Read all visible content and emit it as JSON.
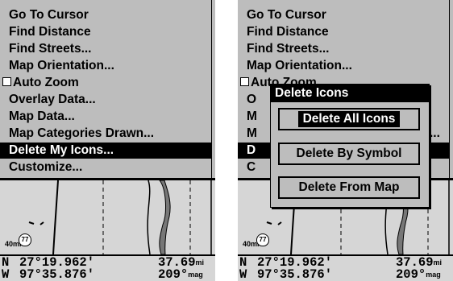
{
  "left_menu": {
    "items": [
      {
        "label": "Go To Cursor"
      },
      {
        "label": "Find Distance"
      },
      {
        "label": "Find Streets..."
      },
      {
        "label": "Map Orientation..."
      },
      {
        "label": "Auto Zoom",
        "checkbox": true,
        "checked": false
      },
      {
        "label": "Overlay Data..."
      },
      {
        "label": "Map Data..."
      },
      {
        "label": "Map Categories Drawn..."
      },
      {
        "label": "Delete My Icons...",
        "selected": true
      },
      {
        "label": "Customize..."
      }
    ]
  },
  "right_menu": {
    "items": [
      {
        "label": "Go To Cursor"
      },
      {
        "label": "Find Distance"
      },
      {
        "label": "Find Streets..."
      },
      {
        "label": "Map Orientation..."
      },
      {
        "label": "Auto Zoom"
      },
      {
        "label": "O"
      },
      {
        "label": "M"
      },
      {
        "label": "M"
      },
      {
        "label": "D"
      },
      {
        "label": "C"
      }
    ],
    "peek_text": "..."
  },
  "dialog": {
    "title": "Delete Icons",
    "buttons": [
      {
        "label": "Delete All Icons",
        "active": true
      },
      {
        "label": "Delete By Symbol"
      },
      {
        "label": "Delete From Map"
      }
    ]
  },
  "map": {
    "scale": "40mi",
    "highway": "77"
  },
  "status": {
    "lat_dir": "N",
    "lat": "27°19.962'",
    "lon_dir": "W",
    "lon": "97°35.876'",
    "distance": "37.69",
    "distance_unit": "mi",
    "bearing": "209°",
    "bearing_unit": "mag"
  },
  "colors": {
    "menu_bg": "#bdbdbd",
    "map_bg": "#d6d6d6",
    "selection": "#000000"
  }
}
